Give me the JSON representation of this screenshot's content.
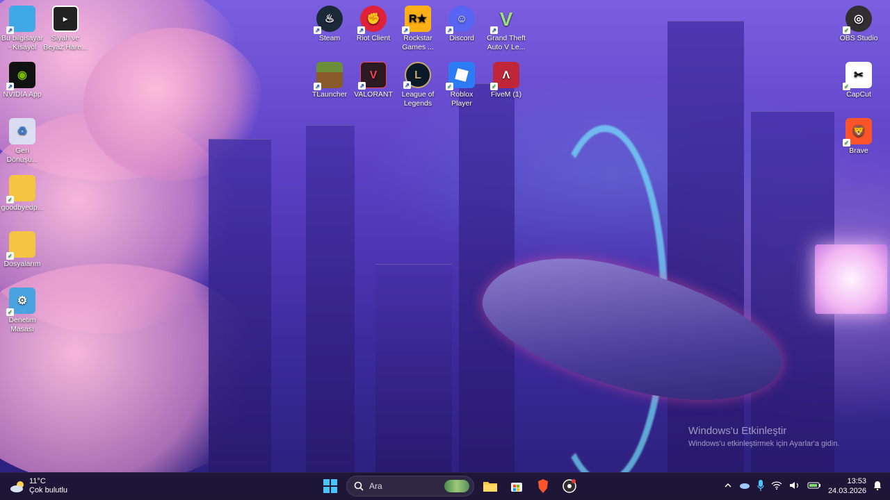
{
  "desktop_icons": [
    {
      "label": "Bu bilgisayar - Kısayol",
      "icon": "monitor-icon",
      "color": "#3fa9e8"
    },
    {
      "label": "Siyah ve Beyaz Hare...",
      "icon": "video-file-icon",
      "color": "#222222"
    },
    {
      "label": "NVIDIA App",
      "icon": "nvidia-icon",
      "color": "#76b900"
    },
    {
      "label": "Geri Dönüşü...",
      "icon": "recycle-bin-icon",
      "color": "#d8e4f0"
    },
    {
      "label": "goodbyedp...",
      "icon": "folder-icon",
      "color": "#f5c542"
    },
    {
      "label": "Dosyalarım",
      "icon": "folder-icon",
      "color": "#f5c542"
    },
    {
      "label": "Denetim Masası",
      "icon": "control-panel-icon",
      "color": "#4aa3df"
    },
    {
      "label": "Steam",
      "icon": "steam-icon",
      "color": "#1b2838"
    },
    {
      "label": "Riot Client",
      "icon": "riot-client-icon",
      "color": "#e0213a"
    },
    {
      "label": "Rockstar Games ...",
      "icon": "rockstar-icon",
      "color": "#fcaf17"
    },
    {
      "label": "Discord",
      "icon": "discord-icon",
      "color": "#5865f2"
    },
    {
      "label": "Grand Theft Auto V Le...",
      "icon": "gta-v-icon",
      "color": "#4c8a3a"
    },
    {
      "label": "TLauncher",
      "icon": "tlauncher-icon",
      "color": "#6b8e3a"
    },
    {
      "label": "VALORANT",
      "icon": "valorant-icon",
      "color": "#fa4454"
    },
    {
      "label": "League of Legends",
      "icon": "league-of-legends-icon",
      "color": "#c8aa6e"
    },
    {
      "label": "Roblox Player",
      "icon": "roblox-icon",
      "color": "#2d7cf6"
    },
    {
      "label": "FiveM (1)",
      "icon": "fivem-icon",
      "color": "#c0263a"
    },
    {
      "label": "OBS Studio",
      "icon": "obs-icon",
      "color": "#302e31"
    },
    {
      "label": "CapCut",
      "icon": "capcut-icon",
      "color": "#ffffff"
    },
    {
      "label": "Brave",
      "icon": "brave-icon",
      "color": "#fb542b"
    }
  ],
  "watermark": {
    "title": "Windows'u Etkinleştir",
    "subtitle": "Windows'u etkinleştirmek için Ayarlar'a gidin."
  },
  "taskbar": {
    "weather": {
      "temp": "11°C",
      "condition": "Çok bulutlu"
    },
    "search_placeholder": "Ara",
    "pinned": [
      "start-icon",
      "search-icon",
      "file-explorer-icon",
      "microsoft-store-icon",
      "brave-icon",
      "obs-icon"
    ],
    "tray": {
      "time": "13:53",
      "date": "24.03.2026"
    }
  }
}
